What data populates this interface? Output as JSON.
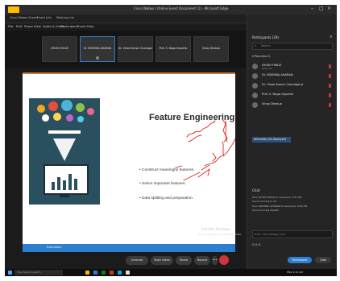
{
  "window": {
    "title": "Cisco Webex | Online Event Document (1) - Microsoft Edge"
  },
  "tabs": [
    "Cisco Webex Events",
    "Event Info",
    "Meeting Info"
  ],
  "menu": [
    "File",
    "Edit",
    "Share",
    "View",
    "Audio & Video",
    "Participant",
    "Event",
    "Help"
  ],
  "video_strip": {
    "tiles": [
      {
        "name": "AYUSH HIKUZ"
      },
      {
        "name": "Dr. KRISHNA AHARAN"
      },
      {
        "name": "Dr. Vinod Kumar Chandgarra"
      },
      {
        "name": "Prof. S. Naga Gayathe"
      },
      {
        "name": "Vinay Dhakua"
      }
    ]
  },
  "slide": {
    "title": "Feature Engineering",
    "bullets": [
      "Construct meaningful features.",
      "Select important features.",
      "Data splitting and preparation."
    ],
    "watermark_line1": "Activate Windows",
    "watermark_line2": "Go to Settings to activate Windows.",
    "footer": "Evaluation",
    "accent_color": "#2f7fd1"
  },
  "controls": {
    "mute_label": "Unmute",
    "video_label": "Start video",
    "share_label": "Share",
    "record_label": "Record",
    "more_label": "•••"
  },
  "panel": {
    "header": "Participants (29)",
    "search_placeholder": "Search",
    "panelists_label": "▾ Panelists 5",
    "participants": [
      {
        "name": "AYUSH HIKUZ",
        "sub": "Host, me"
      },
      {
        "name": "Dr. KRISHNA AHARAN",
        "sub": ""
      },
      {
        "name": "Dr. Vinod Kumar Chandgarra",
        "sub": ""
      },
      {
        "name": "Prof. S. Naga Gayathe",
        "sub": ""
      },
      {
        "name": "Vinay Dhakua",
        "sub": ""
      }
    ],
    "attendees_label": "Attendees (24 displayed)",
    "chat_header": "Chat",
    "chat_lines": [
      "from AYUSH HIKUZ to everyone: 9:37 AM",
      "Good morning to all",
      "from KRISHNA AHARAN to everyone: 9:45 AM",
      "Good morning Madam"
    ],
    "chat_placeholder": "Enter chat message here",
    "qa_label": "Q & A",
    "participants_button": "Participants",
    "chat_button": "Chat"
  },
  "taskbar": {
    "search_text": "Type here to search",
    "tray_text": "ENG  9:42 AM"
  }
}
